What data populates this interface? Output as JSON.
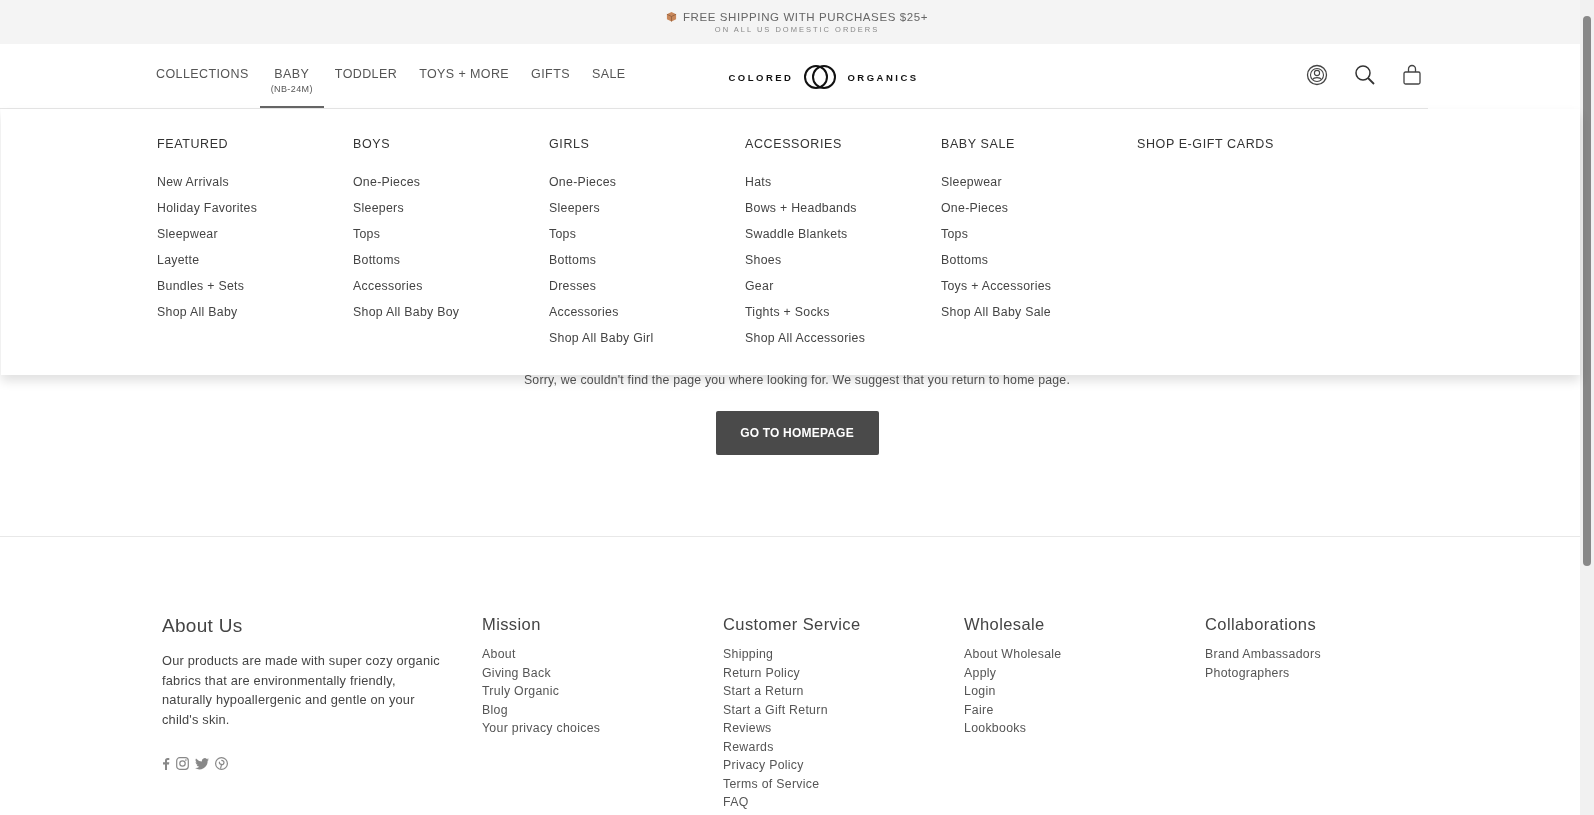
{
  "announcement": {
    "title": "FREE SHIPPING WITH PURCHASES $25+",
    "subtitle": "ON ALL US DOMESTIC ORDERS"
  },
  "nav": [
    {
      "label": "COLLECTIONS",
      "selected": false
    },
    {
      "label": "BABY",
      "sublabel": "(NB-24M)",
      "selected": true
    },
    {
      "label": "TODDLER",
      "selected": false
    },
    {
      "label": "TOYS + MORE",
      "selected": false
    },
    {
      "label": "GIFTS",
      "selected": false
    },
    {
      "label": "SALE",
      "selected": false
    }
  ],
  "logo": {
    "left": "COLORED",
    "right": "ORGANICS"
  },
  "mega_menu": [
    {
      "heading": "FEATURED",
      "items": [
        "New Arrivals",
        "Holiday Favorites",
        "Sleepwear",
        "Layette",
        "Bundles + Sets",
        "Shop All Baby"
      ]
    },
    {
      "heading": "BOYS",
      "items": [
        "One-Pieces",
        "Sleepers",
        "Tops",
        "Bottoms",
        "Accessories",
        "Shop All Baby Boy"
      ]
    },
    {
      "heading": "GIRLS",
      "items": [
        "One-Pieces",
        "Sleepers",
        "Tops",
        "Bottoms",
        "Dresses",
        "Accessories",
        "Shop All Baby Girl"
      ]
    },
    {
      "heading": "ACCESSORIES",
      "items": [
        "Hats",
        "Bows + Headbands",
        "Swaddle Blankets",
        "Shoes",
        "Gear",
        "Tights + Socks",
        "Shop All Accessories"
      ]
    },
    {
      "heading": "BABY SALE",
      "items": [
        "Sleepwear",
        "One-Pieces",
        "Tops",
        "Bottoms",
        "Toys + Accessories",
        "Shop All Baby Sale"
      ]
    },
    {
      "heading": "SHOP E-GIFT CARDS"
    }
  ],
  "message": "Sorry, we couldn't find the page you where looking for. We suggest that you return to home page.",
  "button": "GO TO HOMEPAGE",
  "footer": {
    "about": {
      "heading": "About Us",
      "text": "Our products are made with super cozy organic fabrics that are environmentally friendly, naturally hypoallergenic and gentle on your child's skin."
    },
    "columns": [
      {
        "heading": "Mission",
        "links": [
          "About",
          "Giving Back",
          "Truly Organic",
          "Blog",
          "Your privacy choices"
        ]
      },
      {
        "heading": "Customer Service",
        "links": [
          "Shipping",
          "Return Policy",
          "Start a Return",
          "Start a Gift Return",
          "Reviews",
          "Rewards",
          "Privacy Policy",
          "Terms of Service",
          "FAQ"
        ]
      },
      {
        "heading": "Wholesale",
        "links": [
          "About Wholesale",
          "Apply",
          "Login",
          "Faire",
          "Lookbooks"
        ]
      },
      {
        "heading": "Collaborations",
        "links": [
          "Brand Ambassadors",
          "Photographers"
        ]
      }
    ]
  }
}
